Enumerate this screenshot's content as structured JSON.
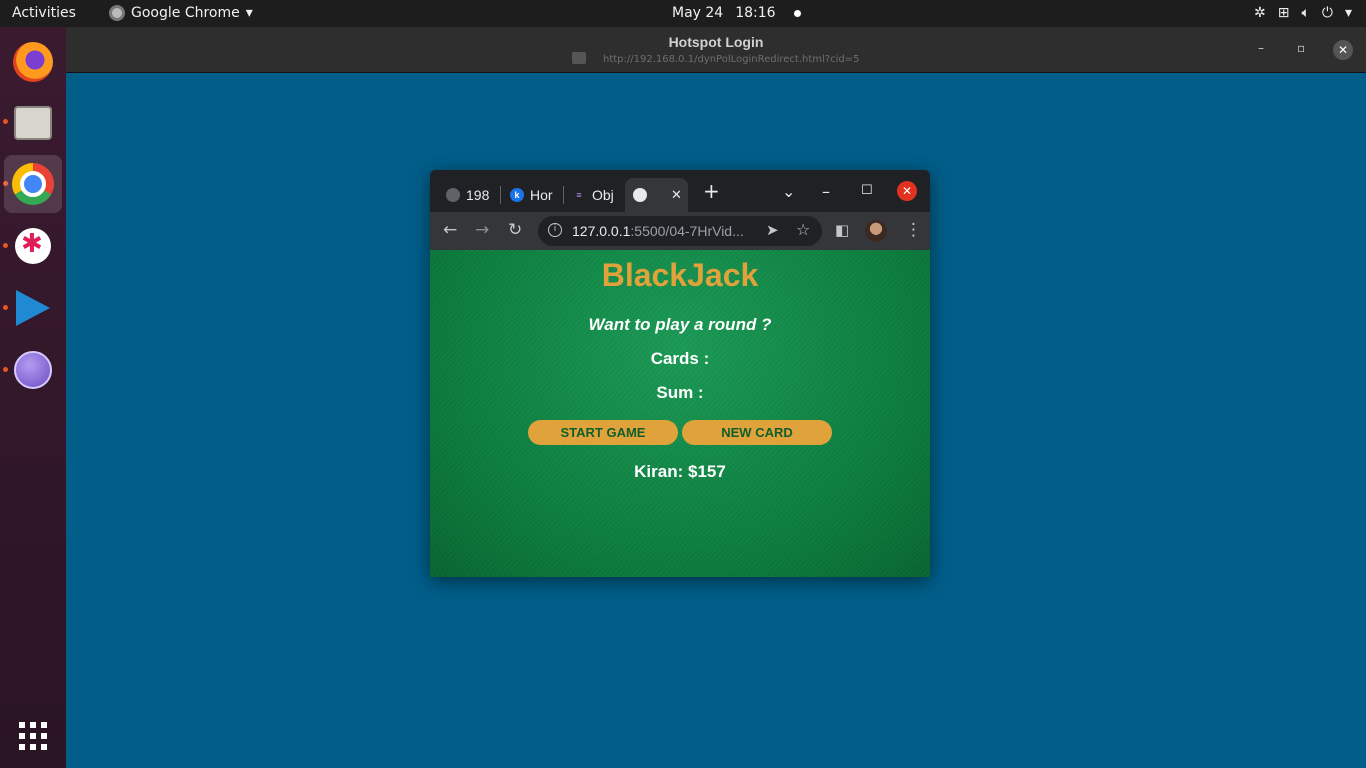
{
  "topbar": {
    "activities": "Activities",
    "app_name": "Google Chrome",
    "app_caret": "▾",
    "date": "May 24",
    "time": "18:16"
  },
  "hotspot_window": {
    "title": "Hotspot Login",
    "url": "http://192.168.0.1/dynPolLoginRedirect.html?cid=5"
  },
  "chrome": {
    "tabs": [
      {
        "label": "198",
        "icon": "globe-icon"
      },
      {
        "label": "Hor",
        "icon": "k-icon"
      },
      {
        "label": "Obj",
        "icon": "bars-icon"
      },
      {
        "label": "",
        "icon": "globe-icon",
        "active": true
      }
    ],
    "address": {
      "host": "127.0.0.1",
      "path": ":5500/04-7HrVid..."
    }
  },
  "page": {
    "title": "BlackJack",
    "message": "Want to play a round ?",
    "cards_label": "Cards :",
    "sum_label": "Sum :",
    "start_button": "START GAME",
    "new_card_button": "NEW CARD",
    "player": "Kiran: $157"
  },
  "colors": {
    "desktop": "#005e89",
    "title_gold": "#e0a33b",
    "felt_green": "#0a7a3c",
    "close_red": "#e0321f"
  }
}
